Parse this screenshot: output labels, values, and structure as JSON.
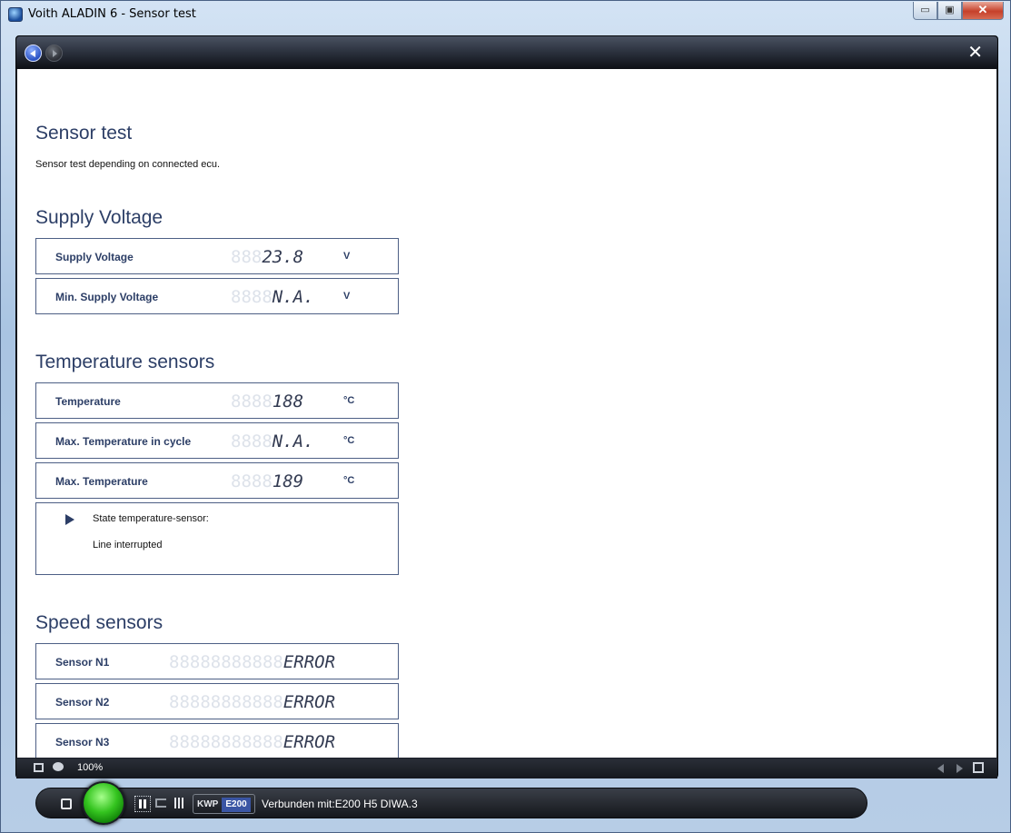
{
  "window": {
    "title": "Voith ALADIN 6 - Sensor test",
    "min_glyph": "▭",
    "max_glyph": "▣",
    "close_glyph": "✕"
  },
  "frame": {
    "close_glyph": "✕"
  },
  "page": {
    "title": "Sensor test",
    "description": "Sensor test depending on connected ecu."
  },
  "sections": {
    "supply": {
      "title": "Supply Voltage",
      "rows": [
        {
          "label": "Supply Voltage",
          "ghost": "888",
          "value": "23.8",
          "unit": "V"
        },
        {
          "label": "Min. Supply Voltage",
          "ghost": "8888",
          "value": "N.A.",
          "unit": "V"
        }
      ]
    },
    "temperature": {
      "title": "Temperature sensors",
      "rows": [
        {
          "label": "Temperature",
          "ghost": "8888",
          "value": "188",
          "unit": "°C"
        },
        {
          "label": "Max. Temperature in cycle",
          "ghost": "8888",
          "value": "N.A.",
          "unit": "°C"
        },
        {
          "label": "Max. Temperature",
          "ghost": "8888",
          "value": "189",
          "unit": "°C"
        }
      ],
      "state_label": "State temperature-sensor:",
      "state_value": "Line interrupted"
    },
    "speed": {
      "title": "Speed sensors",
      "rows": [
        {
          "label": "Sensor N1",
          "ghost": "88888888888",
          "value": "ERROR"
        },
        {
          "label": "Sensor N2",
          "ghost": "88888888888",
          "value": "ERROR"
        },
        {
          "label": "Sensor N3",
          "ghost": "88888888888",
          "value": "ERROR"
        }
      ]
    }
  },
  "footer": {
    "zoom": "100%"
  },
  "statusbar": {
    "protocol": "KWP",
    "ecu": "E200",
    "connection": "Verbunden mit:E200 H5  DIWA.3",
    "led_color": "#34c41f"
  },
  "icons": [
    "app-icon",
    "back-icon",
    "forward-icon",
    "close-icon",
    "fit-screen-icon",
    "comment-icon",
    "prev-page-icon",
    "next-page-icon",
    "expand-icon",
    "stop-icon",
    "pause-icon",
    "loop-icon",
    "grid-icon",
    "status-led-icon"
  ]
}
